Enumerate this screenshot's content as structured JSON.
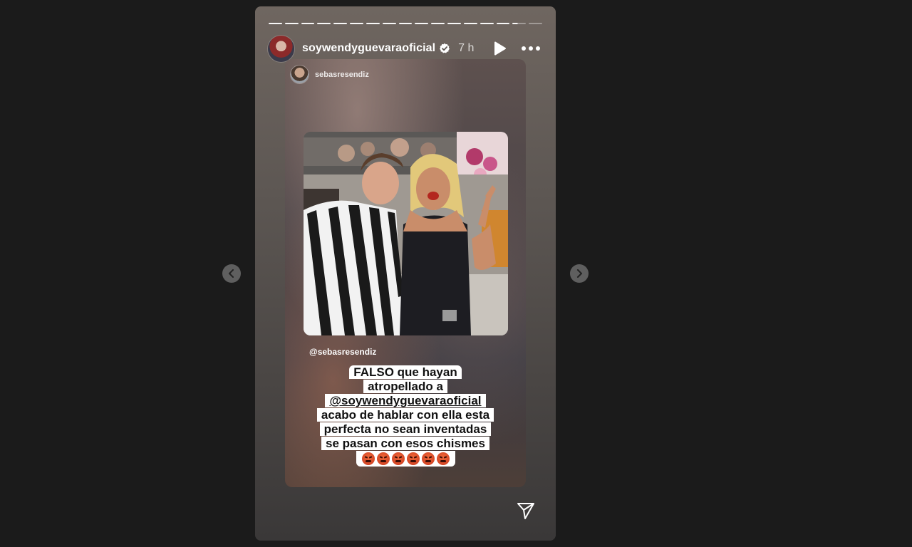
{
  "story": {
    "progress_total_segments": 17,
    "progress_completed_segments": 15,
    "username": "soywendyguevaraoficial",
    "verified": true,
    "time_ago": "7 h",
    "actions": {
      "play_icon": "play-icon",
      "more_icon": "more-horizontal-icon",
      "send_icon": "send-icon"
    }
  },
  "shared_post": {
    "username": "sebasresendiz",
    "mention_tag": "@sebasresendiz",
    "sticker_lines": [
      "FALSO que hayan",
      "atropellado a",
      "@soywendyguevaraoficial",
      "acabo de hablar con ella esta",
      "perfecta no sean inventadas",
      "se pasan con esos chismes"
    ],
    "emoji_count": 6,
    "emoji_name": "angry-face-emoji"
  },
  "navigation": {
    "prev_icon": "chevron-left-icon",
    "next_icon": "chevron-right-icon"
  },
  "colors": {
    "page_background": "#1b1b1b",
    "verified_badge": "#ffffff",
    "sticker_background": "#ffffff"
  }
}
